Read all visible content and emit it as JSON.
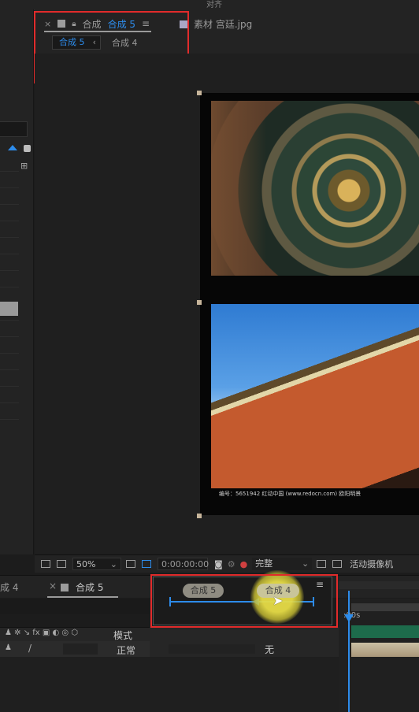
{
  "top_bar": {
    "align_label": "对齐"
  },
  "comp_panel": {
    "tab_prefix": "合成",
    "tab_active": "合成 5",
    "menu_icon": "hamburger-icon",
    "breadcrumb": {
      "current": "合成 5",
      "separator": "‹",
      "previous": "合成 4"
    }
  },
  "source_panel": {
    "label": "素材 宫廷.jpg",
    "color": "#a9a6c4"
  },
  "viewer": {
    "caption": "编号：5651942   红动中国 (www.redocn.com)   欧阳明景"
  },
  "viewer_footer": {
    "zoom": "50%",
    "timecode": "0:00:00:00",
    "quality": "完整",
    "camera": "活动摄像机"
  },
  "timeline": {
    "tab_left": "成 4",
    "tab_active": "合成 5",
    "column_mode": "模式",
    "layer_mode": "正常",
    "layer_trkmat": "无",
    "time_marker": ":00s",
    "flow": {
      "node_left": "合成 5",
      "node_right": "合成 4"
    }
  },
  "highlight_color": "#e12b2b",
  "accent_color": "#2d8ceb"
}
